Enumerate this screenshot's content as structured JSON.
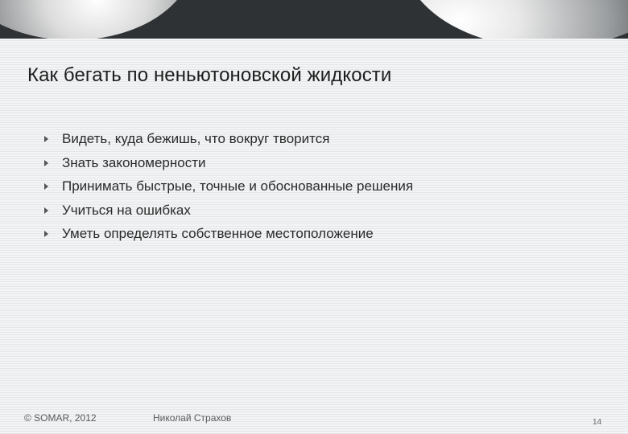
{
  "slide": {
    "title": "Как бегать по неньютоновской жидкости",
    "bullets": [
      "Видеть, куда бежишь, что вокруг творится",
      "Знать закономерности",
      "Принимать быстрые, точные и обоснованные решения",
      "Учиться на ошибках",
      "Уметь определять собственное местоположение"
    ]
  },
  "footer": {
    "copyright": "© SOMAR, 2012",
    "author": "Николай Страхов",
    "page_number": "14"
  },
  "colors": {
    "banner": "#2f3234",
    "background": "#eef0f1",
    "text": "#2a2a2a"
  }
}
